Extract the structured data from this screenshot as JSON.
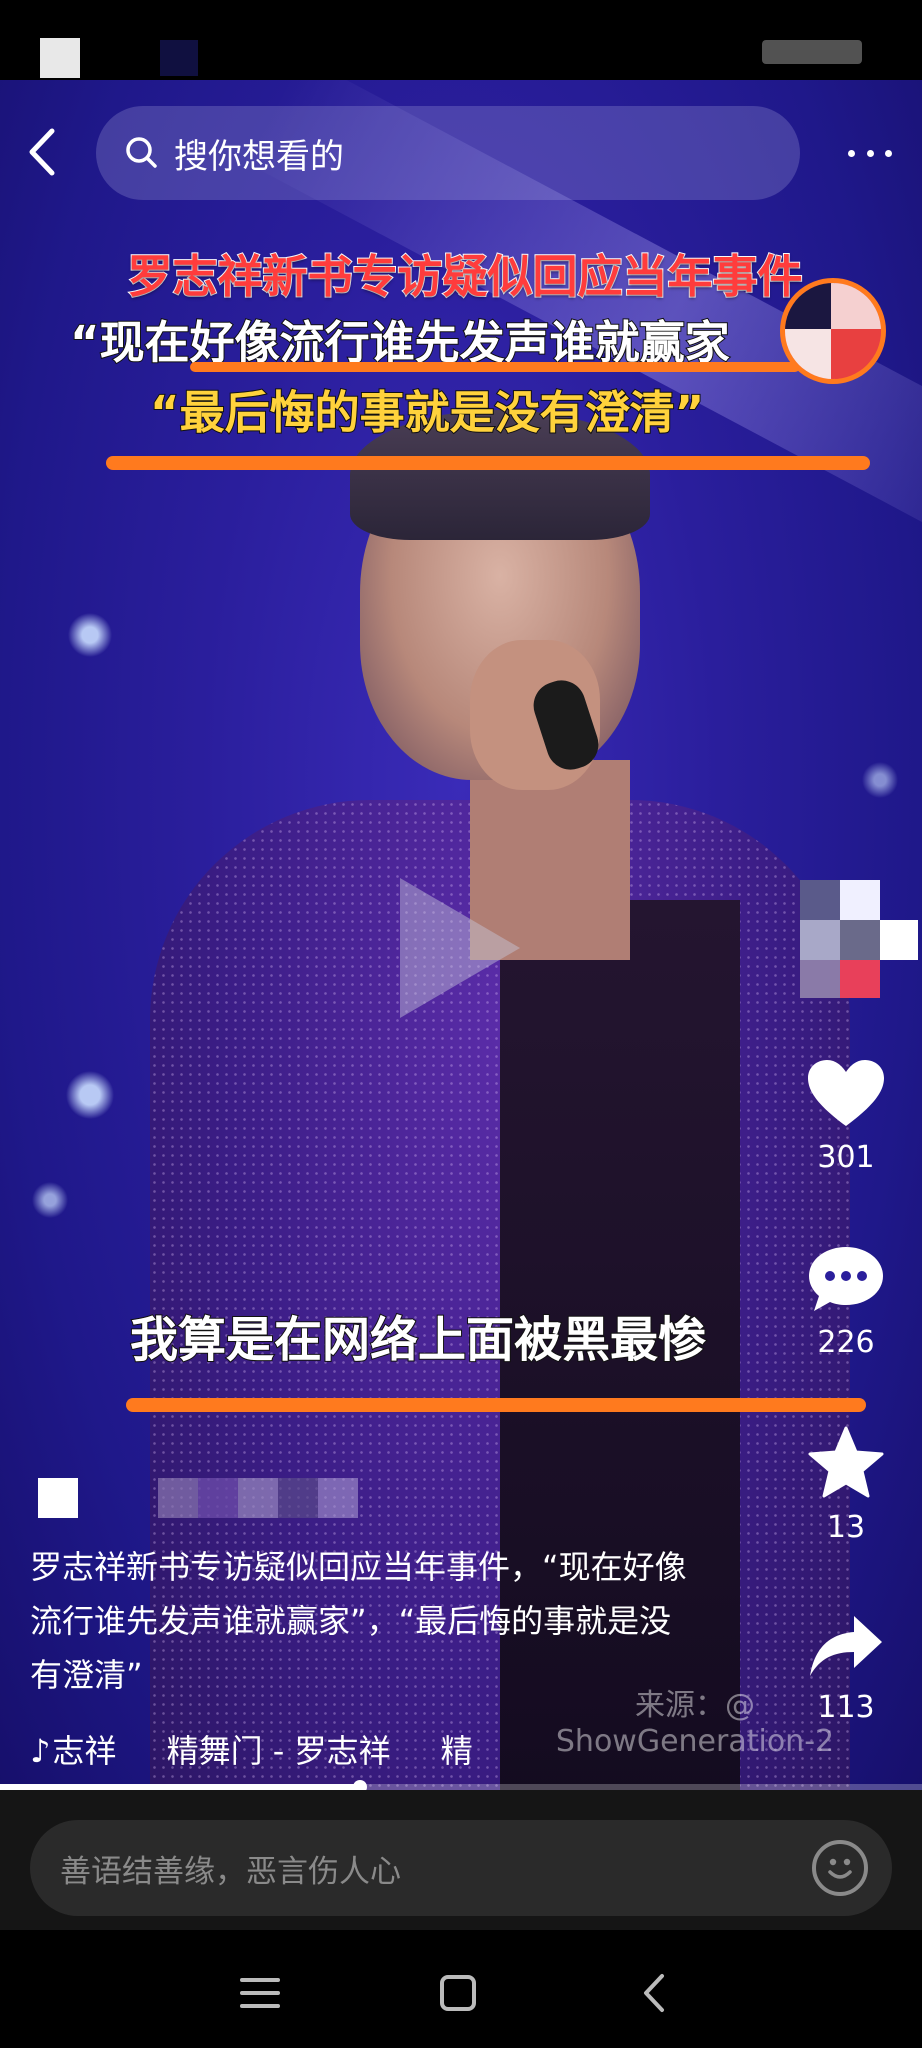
{
  "search": {
    "placeholder": "搜你想看的"
  },
  "overlay": {
    "title": "罗志祥新书专访疑似回应当年事件",
    "quote1": "“现在好像流行谁先发声谁就赢家",
    "quote2": "“最后悔的事就是没有澄清”",
    "bottom": "我算是在网络上面被黑最惨"
  },
  "actions": {
    "like_count": "301",
    "comment_count": "226",
    "favorite_count": "13",
    "share_count": "113"
  },
  "caption": "罗志祥新书专访疑似回应当年事件，“现在好像流行谁先发声谁就赢家”，“最后悔的事就是没有澄清”",
  "tags": [
    "志祥",
    "精舞门 - 罗志祥",
    "精"
  ],
  "watermark": {
    "line1": "来源：@",
    "line2": "ShowGeneration-2"
  },
  "progress": {
    "fraction": 0.39
  },
  "comment": {
    "placeholder": "善语结善缘，恶言伤人心"
  },
  "colors": {
    "accent": "#ff7a1e",
    "title_red": "#ff3c3c",
    "quote_yellow": "#ffd23c"
  }
}
